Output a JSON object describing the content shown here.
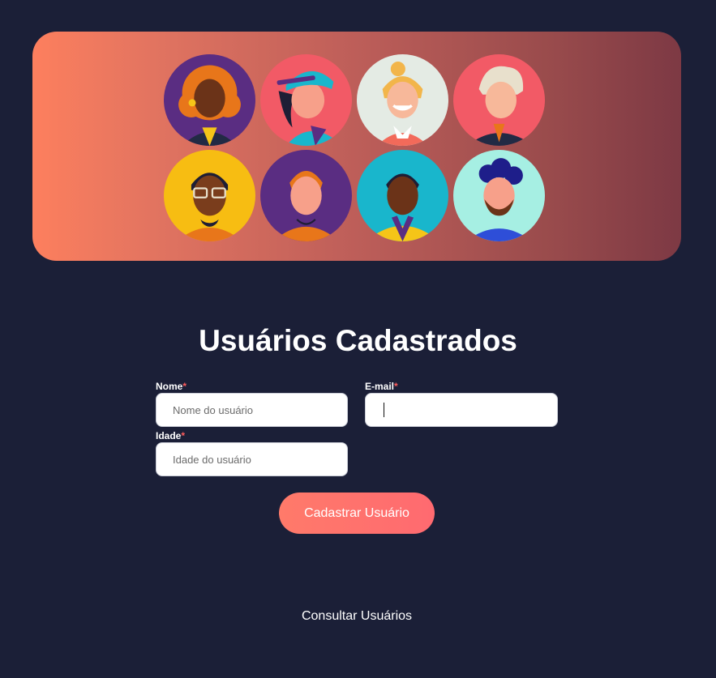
{
  "banner": {
    "avatars": [
      {
        "name": "avatar-woman-curly-orange-hair",
        "bg": "#5a2d82"
      },
      {
        "name": "avatar-woman-teal-cap",
        "bg": "#f25a66"
      },
      {
        "name": "avatar-woman-blonde-ponytail",
        "bg": "#e4ebe4"
      },
      {
        "name": "avatar-man-grey-hair",
        "bg": "#f25a66"
      },
      {
        "name": "avatar-man-glasses",
        "bg": "#f7bd12"
      },
      {
        "name": "avatar-boy-red-hair",
        "bg": "#5a2d82"
      },
      {
        "name": "avatar-man-yellow-jacket",
        "bg": "#19b6cc"
      },
      {
        "name": "avatar-man-beard",
        "bg": "#a6efe3"
      }
    ]
  },
  "page": {
    "title": "Usuários Cadastrados"
  },
  "form": {
    "name_label": "Nome",
    "name_placeholder": "Nome do usuário",
    "email_label": "E-mail",
    "email_value": "",
    "age_label": "Idade",
    "age_placeholder": "Idade do usuário",
    "required_mark": "*",
    "submit_label": "Cadastrar Usuário"
  },
  "footer": {
    "consult_link": "Consultar Usuários"
  },
  "colors": {
    "background": "#1b1f37",
    "accent": "#ff6e6c",
    "required": "#ff5c5c"
  }
}
